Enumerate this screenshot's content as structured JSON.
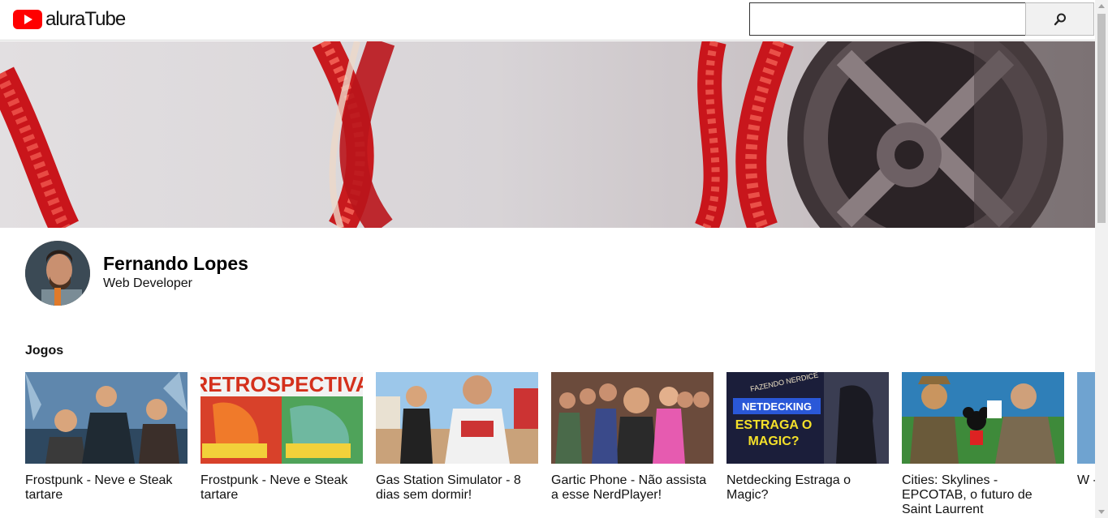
{
  "header": {
    "logo_text": "aluraTube",
    "search_placeholder": "",
    "search_value": "",
    "search_icon": "search-icon"
  },
  "profile": {
    "name": "Fernando Lopes",
    "role": "Web Developer"
  },
  "sections": [
    {
      "title": "Jogos",
      "videos": [
        {
          "title": "Frostpunk - Neve e Steak tartare"
        },
        {
          "title": "Frostpunk - Neve e Steak tartare"
        },
        {
          "title": "Gas Station Simulator - 8 dias sem dormir!"
        },
        {
          "title": "Gartic Phone - Não assista a esse NerdPlayer!"
        },
        {
          "title": "Netdecking Estraga o Magic?"
        },
        {
          "title": "Cities: Skylines - EPCOTAB, o futuro de Saint Laurrent"
        },
        {
          "title": "W - M"
        }
      ]
    }
  ],
  "thumb_texts": {
    "retro": "RETROSPECTIVA",
    "netdecking": "NETDECKING",
    "estraga": "ESTRAGA O",
    "magic": "MAGIC?",
    "fazendo": "FAZENDO NERDICE"
  },
  "colors": {
    "brand_red": "#ff0000"
  }
}
